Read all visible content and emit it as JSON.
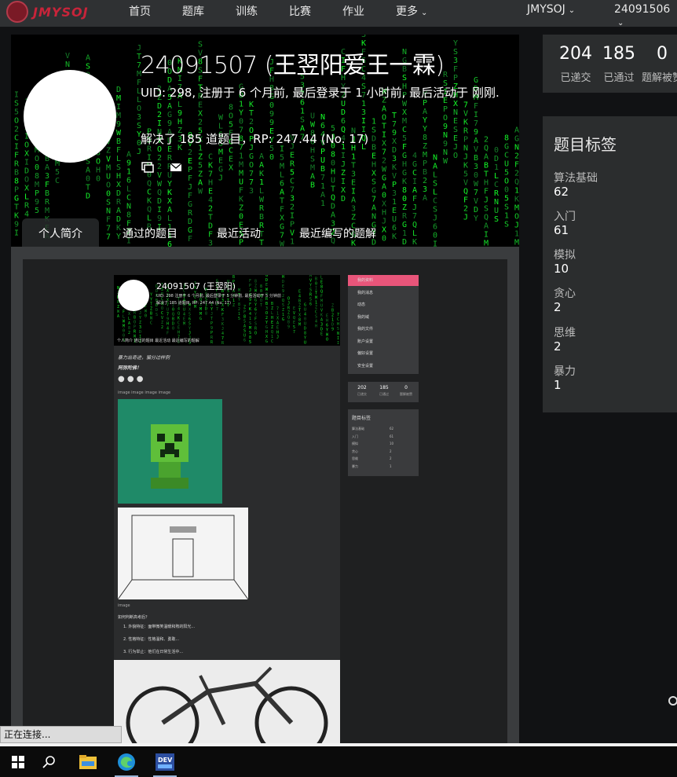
{
  "nav": {
    "logo_text": "JMYSOJ",
    "items": [
      "首页",
      "题库",
      "训练",
      "比赛",
      "作业",
      "更多"
    ],
    "site_menu": "JMYSOJ",
    "user_menu": "24091506"
  },
  "profile": {
    "name": "24091507 (王翌阳爱王一霖)",
    "meta": "UID: 298, 注册于 6 个月前, 最后登录于 1 小时前, 最后活动于 刚刚.",
    "solved": "解决了 185 道题目，RP: 247.44 (No. 17)",
    "tabs": [
      "个人简介",
      "通过的题目",
      "最近活动",
      "最近编写的题解"
    ]
  },
  "stats": [
    {
      "value": "204",
      "label": "已递交"
    },
    {
      "value": "185",
      "label": "已通过"
    },
    {
      "value": "0",
      "label": "题解被赞"
    }
  ],
  "tags": {
    "title": "题目标签",
    "items": [
      {
        "name": "算法基础",
        "count": "62"
      },
      {
        "name": "入门",
        "count": "61"
      },
      {
        "name": "模拟",
        "count": "10"
      },
      {
        "name": "贪心",
        "count": "2"
      },
      {
        "name": "思维",
        "count": "2"
      },
      {
        "name": "暴力",
        "count": "1"
      }
    ]
  },
  "mini": {
    "name": "24091507 (王翌阳)",
    "meta1": "UID: 298 注册于 6 个月前, 最后登录于 5 分钟前, 最后活动于 5 分钟前",
    "meta2": "解决了 185 道题目, RP: 247.44 (No. 17)",
    "tabs": "个人简介    通过的题目    最近活动    最近编写的题解",
    "motto": "暴力出奇迹，骗分过样例",
    "sub": "阿弥陀佛！",
    "img_alt": "image image image image",
    "img_alt2": "image",
    "question": "如何判断高考后？",
    "list": [
      "1. 外貌特征：面带微笑温暖和煦的阳光...",
      "2. 性格特征：性格温和、勇敢...",
      "3. 行为举止：他们在日常生活中..."
    ],
    "side_menu": [
      "我的资料",
      "我的消息",
      "动态",
      "我的域",
      "我的文件",
      "账户设置",
      "偏好设置",
      "安全设置"
    ],
    "side_stats": [
      {
        "v": "202",
        "l": "已递交"
      },
      {
        "v": "185",
        "l": "已通过"
      },
      {
        "v": "0",
        "l": "题解被赞"
      }
    ],
    "side_tags_title": "题目标签",
    "side_tags": [
      [
        "算法基础",
        "62"
      ],
      [
        "入门",
        "61"
      ],
      [
        "模拟",
        "10"
      ],
      [
        "贪心",
        "2"
      ],
      [
        "思维",
        "2"
      ],
      [
        "暴力",
        "1"
      ]
    ]
  },
  "status_text": "正在连接...",
  "colors": {
    "accent": "#e8557a",
    "brand": "#c8243a",
    "nav_bg": "#2f3133",
    "panel_bg": "#2b2d2e"
  }
}
